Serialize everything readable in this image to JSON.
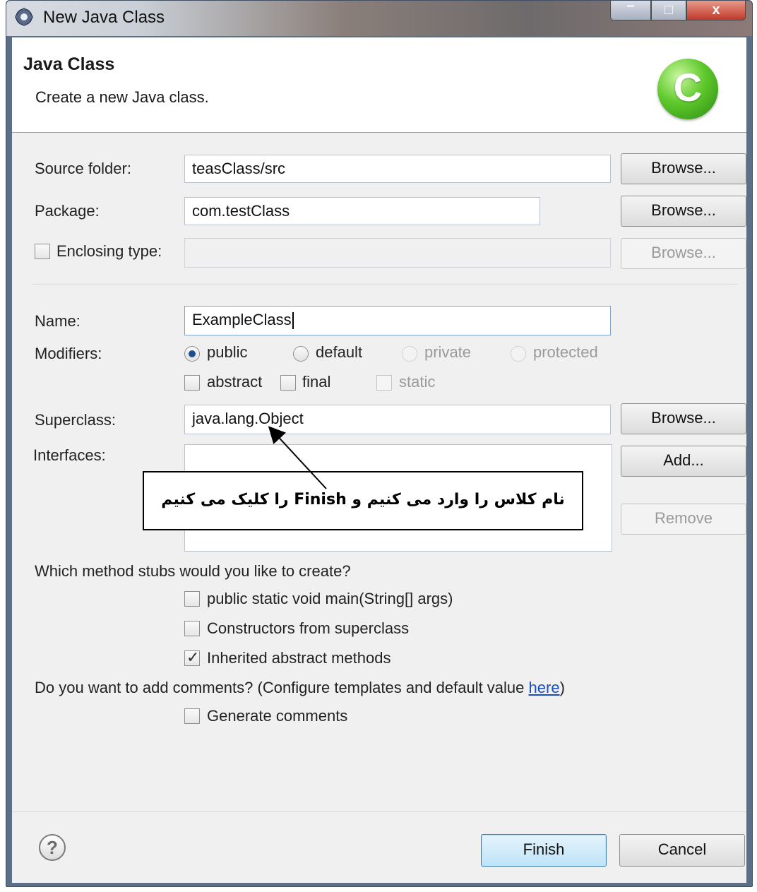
{
  "window": {
    "title": "New Java Class",
    "controls": {
      "minimize": "–",
      "maximize": "□",
      "close": "x"
    }
  },
  "header": {
    "title": "Java Class",
    "subtitle": "Create a new Java class.",
    "icon_letter": "C",
    "icon": "java-class-icon"
  },
  "form": {
    "source_folder": {
      "label": "Source folder:",
      "value": "teasClass/src",
      "browse_label": "Browse..."
    },
    "package": {
      "label": "Package:",
      "value": "com.testClass",
      "browse_label": "Browse..."
    },
    "enclosing_type": {
      "label": "Enclosing type:",
      "checked": false,
      "value": "",
      "browse_label": "Browse..."
    },
    "name": {
      "label": "Name:",
      "value": "ExampleClass"
    },
    "modifiers": {
      "label": "Modifiers:",
      "visibility": [
        {
          "label": "public",
          "selected": true,
          "enabled": true
        },
        {
          "label": "default",
          "selected": false,
          "enabled": true
        },
        {
          "label": "private",
          "selected": false,
          "enabled": false
        },
        {
          "label": "protected",
          "selected": false,
          "enabled": false
        }
      ],
      "flags": [
        {
          "label": "abstract",
          "checked": false,
          "enabled": true
        },
        {
          "label": "final",
          "checked": false,
          "enabled": true
        },
        {
          "label": "static",
          "checked": false,
          "enabled": false
        }
      ]
    },
    "superclass": {
      "label": "Superclass:",
      "value": "java.lang.Object",
      "browse_label": "Browse..."
    },
    "interfaces": {
      "label": "Interfaces:",
      "add_label": "Add...",
      "remove_label": "Remove"
    },
    "method_stubs": {
      "question": "Which method stubs would you like to create?",
      "options": [
        {
          "label": "public static void main(String[] args)",
          "checked": false
        },
        {
          "label": "Constructors from superclass",
          "checked": false
        },
        {
          "label": "Inherited abstract methods",
          "checked": true
        }
      ]
    },
    "comments": {
      "question_prefix": "Do you want to add comments? (Configure templates and default value ",
      "link_text": "here",
      "question_suffix": ")",
      "option": {
        "label": "Generate comments",
        "checked": false
      }
    }
  },
  "annotation": {
    "text": "نام کلاس را وارد می کنیم و Finish را کلیک می کنیم"
  },
  "footer": {
    "help_icon": "help-icon",
    "help_glyph": "?",
    "finish_label": "Finish",
    "cancel_label": "Cancel"
  }
}
